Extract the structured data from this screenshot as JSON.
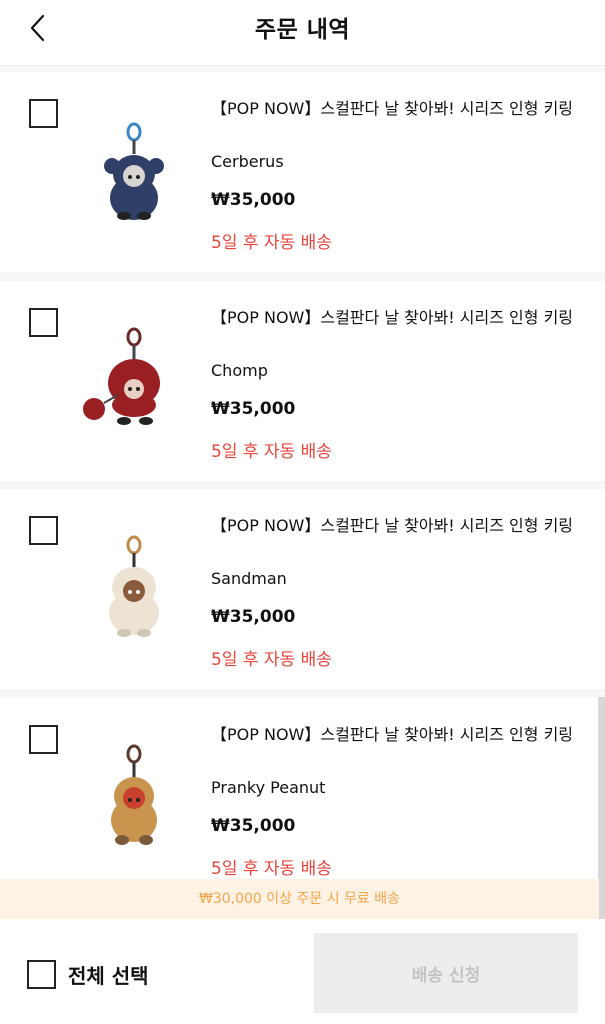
{
  "header": {
    "title": "주문 내역",
    "back_icon": "chevron-left-icon"
  },
  "items": [
    {
      "name": "【POP NOW】스컬판다 날 찾아봐! 시리즈 인형 키링",
      "option": "Cerberus",
      "price": "₩35,000",
      "status": "5일 후 자동 배송",
      "doll_color": "#2f3f66"
    },
    {
      "name": "【POP NOW】스컬판다 날 찾아봐! 시리즈 인형 키링",
      "option": "Chomp",
      "price": "₩35,000",
      "status": "5일 후 자동 배송",
      "doll_color": "#9a1f22"
    },
    {
      "name": "【POP NOW】스컬판다 날 찾아봐! 시리즈 인형 키링",
      "option": "Sandman",
      "price": "₩35,000",
      "status": "5일 후 자동 배송",
      "doll_color": "#ece3d2"
    },
    {
      "name": "【POP NOW】스컬판다 날 찾아봐! 시리즈 인형 키링",
      "option": "Pranky Peanut",
      "price": "₩35,000",
      "status": "5일 후 자동 배송",
      "doll_color": "#c9954e"
    }
  ],
  "banner": {
    "text": "₩30,000 이상 주문 시 무료 배송"
  },
  "bottom": {
    "select_all_label": "전체 선택",
    "ship_button_label": "배송 신청"
  },
  "colors": {
    "status_red": "#e8443a",
    "banner_bg": "#fdf2e3",
    "banner_text": "#f3a64a",
    "disabled_button": "#eeecec"
  }
}
